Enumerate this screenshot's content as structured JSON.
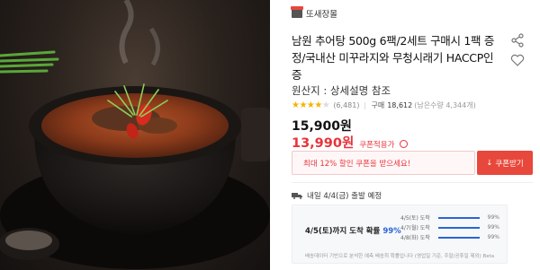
{
  "seller": {
    "name": "또새장몰"
  },
  "product": {
    "title": "남원 추어탕 500g 6팩/2세트 구매시 1팩 증정/국내산 미꾸라지와 무청시래기 HACCP인증",
    "origin": "원산지 : 상세설명 참조",
    "rating": {
      "stars": 4.5,
      "review_count": "(6,481)"
    },
    "purchase": {
      "label": "구매",
      "count": "18,612",
      "recent": "(남은수량 4,344개)"
    },
    "price": {
      "original": "15,900원",
      "sale": "13,990원",
      "coupon_label": "쿠폰적용가"
    }
  },
  "coupon": {
    "message": "최대 12% 할인 쿠폰을 받으세요!",
    "button_label": "쿠폰받기"
  },
  "delivery": {
    "label": "내일 4/4(금) 출발 예정",
    "forecast": {
      "main_prefix": "4/5(토)까지 도착 확률",
      "main_pct": "99%",
      "rows": [
        {
          "date": "4/5(토) 도착",
          "pct": "99%",
          "fill": 0.99
        },
        {
          "date": "4/7(월) 도착",
          "pct": "99%",
          "fill": 0.99
        },
        {
          "date": "4/8(화) 도착",
          "pct": "99%",
          "fill": 0.99
        }
      ],
      "note": "배송데이터 기반으로 분석한 예측 배송최 확률입니다  (영업일 기준, 주말/공휴일 제외)  Beta"
    }
  },
  "icons": {
    "share": "share-icon",
    "like": "heart-icon",
    "truck": "truck-icon",
    "download": "download-icon",
    "store": "store-icon"
  },
  "colors": {
    "accent_red": "#e8333b",
    "button_red": "#e8473b",
    "forecast_blue": "#2a64d6",
    "star": "#f4b400"
  }
}
